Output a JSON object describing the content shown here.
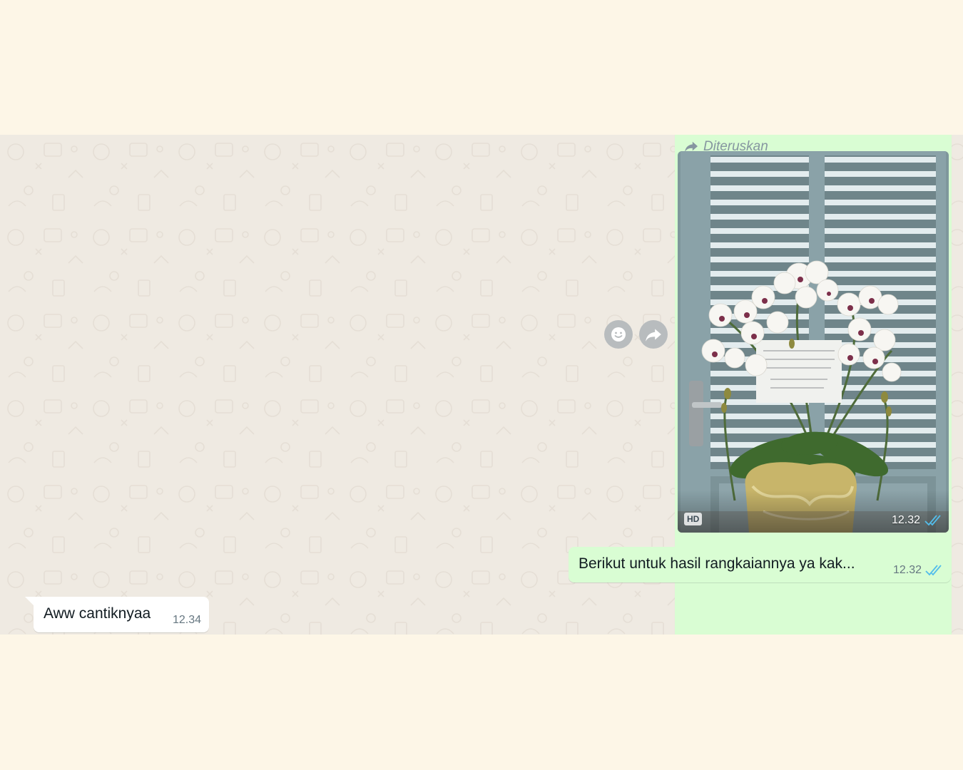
{
  "conversation": {
    "messages": [
      {
        "direction": "outgoing",
        "forwarded_label": "Diteruskan",
        "media_badge": "HD",
        "time": "12.32",
        "status_icon": "double-check-read-icon"
      },
      {
        "direction": "outgoing",
        "text": "Berikut untuk hasil rangkaiannya ya kak...",
        "time": "12.32",
        "status_icon": "double-check-read-icon"
      },
      {
        "direction": "incoming",
        "text": "Aww cantiknyaa",
        "time": "12.34"
      }
    ],
    "hover_actions": [
      "emoji-reaction-icon",
      "forward-icon"
    ]
  },
  "colors": {
    "app_background": "#fdf6e7",
    "chat_wallpaper": "#efeae2",
    "outgoing_bubble": "#d9fdd3",
    "incoming_bubble": "#ffffff",
    "read_tick": "#53bdeb",
    "meta_text": "#667781"
  }
}
